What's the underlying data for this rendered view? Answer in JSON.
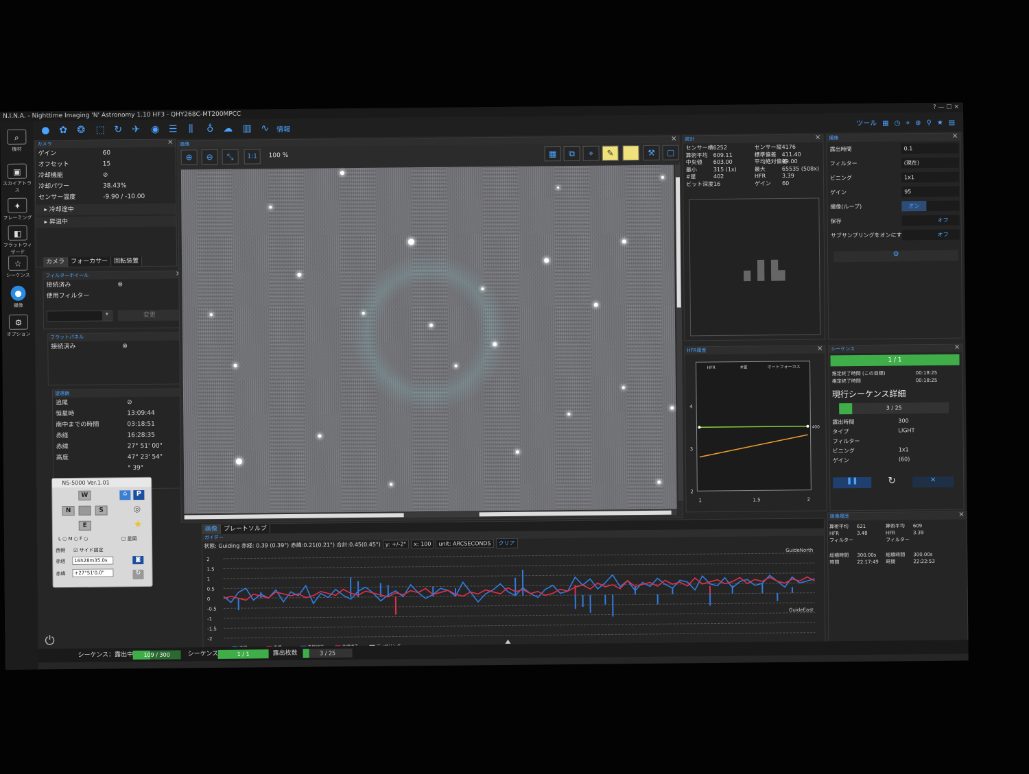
{
  "app": {
    "title": "N.I.N.A. - Nighttime Imaging 'N' Astronomy 1.10 HF3",
    "profile": "QHY268C-MT200MPCC"
  },
  "toolbar": {
    "info": "情報",
    "tools": [
      "ツール"
    ]
  },
  "sidebar": [
    {
      "label": "機材",
      "icon": "telescope-icon"
    },
    {
      "label": "スカイアトラス",
      "icon": "atlas-icon"
    },
    {
      "label": "フレーミング",
      "icon": "framing-icon"
    },
    {
      "label": "フラットウィザード",
      "icon": "flat-wizard-icon"
    },
    {
      "label": "シーケンス",
      "icon": "sequence-icon"
    },
    {
      "label": "撮像",
      "icon": "imaging-icon"
    },
    {
      "label": "オプション",
      "icon": "gear-icon"
    }
  ],
  "camera": {
    "header": "カメラ",
    "rows": [
      {
        "k": "ゲイン",
        "v": "60"
      },
      {
        "k": "オフセット",
        "v": "15"
      },
      {
        "k": "冷却機能",
        "v": "⊘"
      },
      {
        "k": "冷却パワー",
        "v": "38.43%"
      },
      {
        "k": "センサー温度",
        "v": "-9.90 / -10.00"
      }
    ],
    "cooling": "冷却途中",
    "warming": "昇温中",
    "tabs": [
      "カメラ",
      "フォーカサー",
      "回転装置"
    ]
  },
  "filterwheel": {
    "header": "フィルターホイール",
    "rows": [
      {
        "k": "接続済み",
        "v": "⊗"
      },
      {
        "k": "使用フィルター",
        "v": ""
      }
    ],
    "change": "変更"
  },
  "flatpanel": {
    "header": "フラットパネル",
    "rows": [
      {
        "k": "接続済み",
        "v": "⊗"
      }
    ]
  },
  "telescope": {
    "header": "望遠鏡",
    "rows": [
      {
        "k": "追尾",
        "v": "⊘"
      },
      {
        "k": "恒星時",
        "v": "13:09:44"
      },
      {
        "k": "南中までの時間",
        "v": "03:18:51"
      },
      {
        "k": "赤経",
        "v": "16:28:35"
      },
      {
        "k": "赤緯",
        "v": "27° 51' 00\""
      },
      {
        "k": "高度",
        "v": "47° 23' 54\""
      },
      {
        "k": "",
        "v": "° 39\""
      }
    ]
  },
  "image": {
    "header": "画像",
    "zoom": "100 %",
    "one_to_one": "1:1",
    "bottom_tabs": [
      "画像",
      "プレートソルブ"
    ]
  },
  "stats": {
    "header": "統計",
    "left": [
      {
        "k": "センサー横",
        "v": "6252"
      },
      {
        "k": "算術平均",
        "v": "609.11"
      },
      {
        "k": "中央値",
        "v": "603.00"
      },
      {
        "k": "最小",
        "v": "315 (1x)"
      },
      {
        "k": "#星",
        "v": "402"
      },
      {
        "k": "ビット深度",
        "v": "16"
      }
    ],
    "right": [
      {
        "k": "センサー縦",
        "v": "4176"
      },
      {
        "k": "標準偏差",
        "v": "411.40"
      },
      {
        "k": "平均絶対偏差",
        "v": "99.00"
      },
      {
        "k": "最大",
        "v": "65535 (508x)"
      },
      {
        "k": "HFR",
        "v": "3.39"
      },
      {
        "k": "ゲイン",
        "v": "60"
      }
    ]
  },
  "hfr": {
    "header": "HFR履歴",
    "legend": [
      "HFR",
      "#星",
      "オートフォーカス"
    ],
    "y_ticks": [
      "4",
      "3",
      "2"
    ],
    "x_ticks": [
      "1",
      "1.5",
      "2"
    ],
    "right_value": "400",
    "hfr_line": [
      2.8,
      3.3
    ],
    "stars_line": [
      3.5,
      3.5
    ],
    "colors": {
      "hfr": "#f0a030",
      "stars": "#8bd13a"
    }
  },
  "capture": {
    "header": "撮像",
    "rows": [
      {
        "k": "露出時間",
        "v": "0.1"
      },
      {
        "k": "フィルター",
        "v": "(現在)"
      },
      {
        "k": "ビニング",
        "v": "1x1"
      },
      {
        "k": "ゲイン",
        "v": "95"
      },
      {
        "k": "撮像(ループ)",
        "v": "オン"
      },
      {
        "k": "保存",
        "v": "オフ"
      },
      {
        "k": "サブサンプリングをオンにする",
        "v": "オフ"
      }
    ]
  },
  "sequence": {
    "header": "シーケンス",
    "progress": "1 / 1",
    "eta_label": "推定終了時間 (この目標)",
    "eta": "00:18:25",
    "eta2_label": "推定終了時間",
    "eta2": "00:18:25",
    "detail_title": "現行シーケンス詳細",
    "count": "3 / 25",
    "count_fraction": 0.12,
    "rows": [
      {
        "k": "露出時間",
        "v": "300"
      },
      {
        "k": "タイプ",
        "v": "LIGHT"
      },
      {
        "k": "フィルター",
        "v": ""
      },
      {
        "k": "ビニング",
        "v": "1x1"
      },
      {
        "k": "ゲイン",
        "v": "(60)"
      }
    ]
  },
  "guider": {
    "header": "ガイダー",
    "status": "状態: Guiding 赤経: 0.39 (0.39\") 赤緯:0.21(0.21\") 合計:0.45(0.45\")",
    "y_scale": "y: +/-2\"",
    "x_scale": "x: 100",
    "unit": "unit: ARCSECONDS",
    "clear": "クリア",
    "north": "GuideNorth",
    "east": "GuideEast",
    "y_ticks": [
      "2",
      "1.5",
      "1",
      "0.5",
      "0",
      "-0.5",
      "-1",
      "-1.5",
      "-2"
    ],
    "legend": [
      "赤経",
      "赤緯",
      "赤経修正",
      "赤緯修正",
      "ディザリング"
    ],
    "colors": {
      "ra": "#2f7de0",
      "dec": "#e0304a"
    },
    "ra": [
      0.1,
      -0.2,
      0.3,
      0.5,
      -0.1,
      0.2,
      0.0,
      0.4,
      -0.2,
      0.3,
      0.1,
      0.6,
      -0.3,
      0.2,
      0.0,
      0.4,
      0.1,
      -0.1,
      0.3,
      0.5,
      0.2,
      -0.2,
      0.1,
      0.3,
      0.0,
      0.6,
      0.2,
      -0.1,
      0.1,
      0.4,
      0.3,
      0.0,
      0.7,
      0.2,
      -0.3,
      0.1,
      0.3,
      0.6,
      0.2,
      0.0,
      0.4,
      0.1,
      -0.1,
      0.3,
      0.5,
      0.1,
      0.2,
      0.9,
      0.5,
      0.8,
      0.3,
      0.6,
      1.0,
      0.4,
      0.7,
      0.2,
      0.6,
      0.4,
      0.8,
      0.5,
      0.3,
      0.7,
      0.6,
      0.2,
      0.9,
      0.5,
      0.4,
      0.8,
      0.3,
      0.6,
      0.7,
      0.4,
      0.5,
      0.9,
      0.6,
      0.3,
      0.8,
      0.5,
      0.6,
      0.7
    ],
    "dec": [
      0.0,
      0.1,
      0.0,
      -0.1,
      0.2,
      0.1,
      0.0,
      0.3,
      0.2,
      0.1,
      0.2,
      0.0,
      0.1,
      0.3,
      0.2,
      0.1,
      0.4,
      0.2,
      0.1,
      0.3,
      0.2,
      0.1,
      0.0,
      0.2,
      0.1,
      0.3,
      0.2,
      0.4,
      0.1,
      0.2,
      0.3,
      0.1,
      0.0,
      0.2,
      0.1,
      0.3,
      0.2,
      0.1,
      0.4,
      0.2,
      0.3,
      0.1,
      0.2,
      0.0,
      0.1,
      0.3,
      0.2,
      0.4,
      0.5,
      0.3,
      0.6,
      0.4,
      0.5,
      0.3,
      0.7,
      0.4,
      0.5,
      0.6,
      0.4,
      0.7,
      0.5,
      0.6,
      0.4,
      0.8,
      0.5,
      0.6,
      0.7,
      0.5,
      0.6,
      0.8,
      0.5,
      0.7,
      0.6,
      0.8,
      0.6,
      0.5,
      0.7,
      0.6,
      0.8,
      0.6
    ],
    "ra_corr": [
      0,
      0,
      -0.6,
      0,
      0,
      0.3,
      0,
      0,
      0,
      0,
      0,
      0,
      0,
      0,
      0,
      0,
      0,
      1.0,
      0.8,
      0,
      0,
      0.7,
      0.6,
      0,
      0,
      0,
      0,
      0,
      0.5,
      0,
      0,
      0.4,
      0,
      0,
      0,
      0,
      0,
      0,
      0,
      0.9,
      1.3,
      0,
      0,
      0,
      0,
      0,
      0,
      -0.7,
      -0.6,
      -0.9,
      0,
      -0.5,
      -1.1,
      0,
      0,
      0.4,
      0,
      0,
      -0.5,
      0,
      0.3,
      0,
      0,
      0,
      0,
      -0.6,
      0,
      0,
      0.4,
      0,
      0,
      0,
      0.5,
      0,
      -0.4,
      0,
      0.3,
      0,
      0,
      0
    ],
    "dec_corr": [
      0,
      0,
      0,
      0,
      0,
      0,
      0,
      0,
      0,
      0,
      0,
      0,
      0,
      0,
      0,
      0,
      0,
      0,
      0,
      0,
      0,
      0,
      0,
      -0.9,
      0,
      0,
      0,
      0,
      0,
      0,
      0,
      0,
      0,
      0,
      0,
      0,
      0,
      0,
      0,
      0,
      0,
      0,
      0,
      0,
      0,
      0,
      0,
      0.5,
      0,
      0,
      0,
      0,
      0,
      0,
      0,
      0,
      0,
      0,
      0,
      0,
      0,
      0,
      0,
      0,
      0,
      0.4,
      0,
      0,
      0,
      0,
      0,
      0,
      0,
      0,
      0,
      0,
      0,
      0,
      0,
      0
    ]
  },
  "image_history": {
    "header": "画像履歴",
    "left": [
      {
        "k": "算術平均",
        "v": "621"
      },
      {
        "k": "HFR",
        "v": "3.48"
      },
      {
        "k": "フィルター",
        "v": ""
      },
      {
        "k": "総積時間",
        "v": "300.00s"
      },
      {
        "k": "時間",
        "v": "22:17:49"
      }
    ],
    "right": [
      {
        "k": "算術平均",
        "v": "609"
      },
      {
        "k": "HFR",
        "v": "3.39"
      },
      {
        "k": "フィルター",
        "v": ""
      },
      {
        "k": "総積時間",
        "v": "300.00s"
      },
      {
        "k": "時間",
        "v": "22:22:53"
      }
    ]
  },
  "ns5000": {
    "title": "NS-5000 Ver.1.01",
    "buttons": [
      "W",
      "N",
      "S",
      "E",
      "P"
    ],
    "modes": "L ○ M ○ F ○",
    "lock": "サイド固定",
    "west_label": "西側",
    "ra_label": "赤経",
    "ra_value": "16h28m35.0s",
    "dec_label": "赤緯",
    "dec_value": "+27°51'0.0\"",
    "star_label": "星図"
  },
  "statusbar": {
    "seq_label": "シーケンス：露出中",
    "exposure": "109 / 300",
    "exposure_fraction": 0.36,
    "seq2_label": "シーケンス",
    "seq2": "1 / 1",
    "count_label": "露出枚数",
    "count": "3 / 25",
    "count_fraction": 0.12
  }
}
